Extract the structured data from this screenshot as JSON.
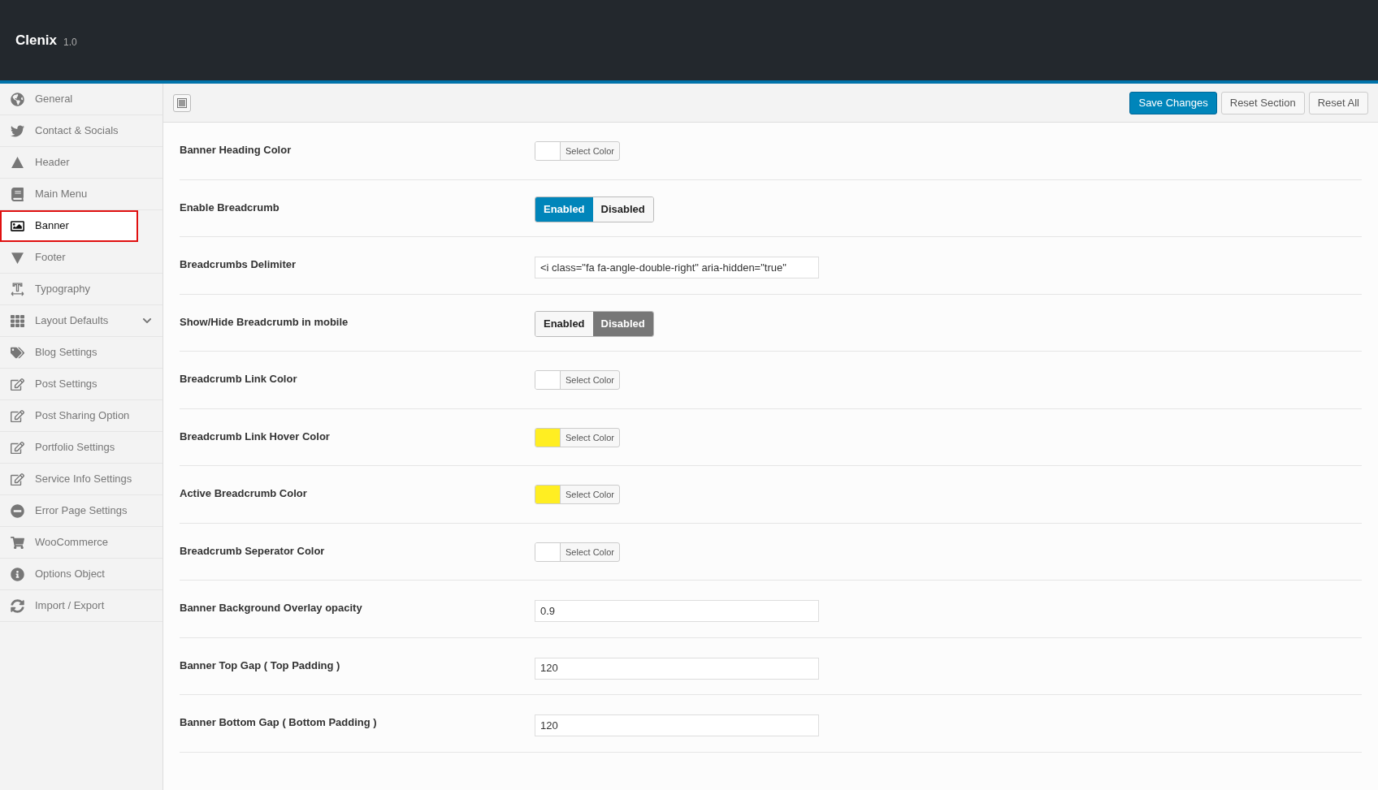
{
  "app": {
    "name": "Clenix",
    "version": "1.0"
  },
  "sidebar": {
    "items": [
      {
        "label": "General",
        "selected": false
      },
      {
        "label": "Contact & Socials",
        "selected": false
      },
      {
        "label": "Header",
        "selected": false
      },
      {
        "label": "Main Menu",
        "selected": false
      },
      {
        "label": "Banner",
        "selected": true
      },
      {
        "label": "Footer",
        "selected": false
      },
      {
        "label": "Typography",
        "selected": false
      },
      {
        "label": "Layout Defaults",
        "selected": false,
        "expandable": true
      },
      {
        "label": "Blog Settings",
        "selected": false
      },
      {
        "label": "Post Settings",
        "selected": false
      },
      {
        "label": "Post Sharing Option",
        "selected": false
      },
      {
        "label": "Portfolio Settings",
        "selected": false
      },
      {
        "label": "Service Info Settings",
        "selected": false
      },
      {
        "label": "Error Page Settings",
        "selected": false
      },
      {
        "label": "WooCommerce",
        "selected": false
      },
      {
        "label": "Options Object",
        "selected": false
      },
      {
        "label": "Import / Export",
        "selected": false
      }
    ]
  },
  "toolbar": {
    "buttons": [
      {
        "label": "Save Changes",
        "kind": "primary"
      },
      {
        "label": "Reset Section",
        "kind": "secondary"
      },
      {
        "label": "Reset All",
        "kind": "secondary"
      }
    ]
  },
  "settings": [
    {
      "label": "Banner Heading Color",
      "kind": "color",
      "color": "#ffffff",
      "button": "Select Color"
    },
    {
      "label": "Enable Breadcrumb",
      "kind": "toggle",
      "options": [
        {
          "label": "Enabled",
          "kind": "on",
          "selected": true
        },
        {
          "label": "Disabled",
          "kind": "off",
          "selected": false
        }
      ]
    },
    {
      "label": "Breadcrumbs Delimiter",
      "kind": "text",
      "value": "<i class=\"fa fa-angle-double-right\" aria-hidden=\"true\""
    },
    {
      "label": "Show/Hide Breadcrumb in mobile",
      "kind": "toggle",
      "options": [
        {
          "label": "Enabled",
          "kind": "on",
          "selected": false
        },
        {
          "label": "Disabled",
          "kind": "off",
          "selected": true
        }
      ]
    },
    {
      "label": "Breadcrumb Link Color",
      "kind": "color",
      "color": "#ffffff",
      "button": "Select Color"
    },
    {
      "label": "Breadcrumb Link Hover Color",
      "kind": "color",
      "color": "#ffee22",
      "button": "Select Color"
    },
    {
      "label": "Active Breadcrumb Color",
      "kind": "color",
      "color": "#ffee22",
      "button": "Select Color"
    },
    {
      "label": "Breadcrumb Seperator Color",
      "kind": "color",
      "color": "#ffffff",
      "button": "Select Color"
    },
    {
      "label": "Banner Background Overlay opacity",
      "kind": "text",
      "value": "0.9"
    },
    {
      "label": "Banner Top Gap ( Top Padding )",
      "kind": "text",
      "value": "120"
    },
    {
      "label": "Banner Bottom Gap ( Bottom Padding )",
      "kind": "text",
      "value": "120"
    }
  ]
}
